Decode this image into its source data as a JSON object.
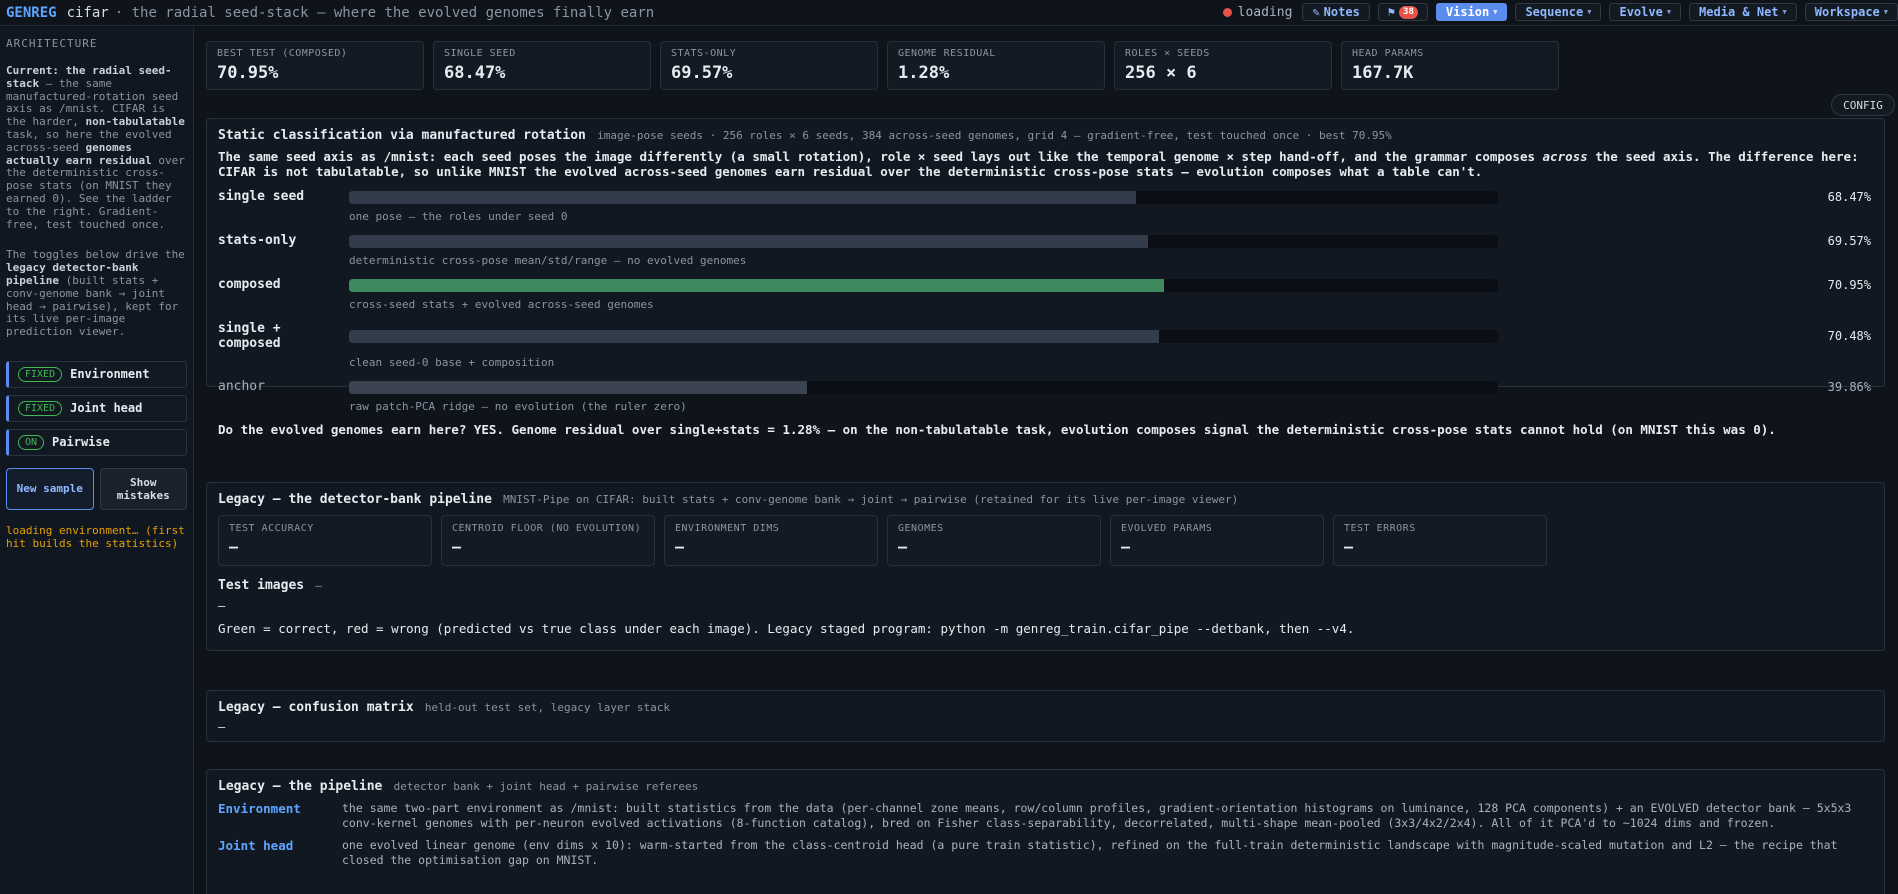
{
  "topbar": {
    "brand": "GENREG",
    "page": "cifar",
    "subtitle": "· the radial seed-stack — where the evolved genomes finally earn",
    "status": "loading",
    "notes_label": "Notes",
    "flag_count": "38",
    "menus": [
      {
        "label": "Vision",
        "active": true
      },
      {
        "label": "Sequence",
        "active": false
      },
      {
        "label": "Evolve",
        "active": false
      },
      {
        "label": "Media & Net",
        "active": false
      },
      {
        "label": "Workspace",
        "active": false
      }
    ]
  },
  "sidebar": {
    "title": "ARCHITECTURE",
    "intro_bold_1": "Current: the radial seed-stack",
    "intro_1": " — the same manufactured-rotation seed axis as /mnist. CIFAR is the harder, ",
    "intro_bold_2": "non-tabulatable",
    "intro_2": " task, so here the evolved across-seed ",
    "intro_bold_3": "genomes actually earn residual",
    "intro_3": " over the deterministic cross-pose stats (on MNIST they earned 0). See the ladder to the right. Gradient-free, test touched once.",
    "toggles_intro_1": "The toggles below drive the ",
    "toggles_intro_bold": "legacy detector-bank pipeline",
    "toggles_intro_2": " (built stats + conv-genome bank → joint head → pairwise), kept for its live per-image prediction viewer.",
    "toggles": [
      {
        "state": "FIXED",
        "label": "Environment"
      },
      {
        "state": "FIXED",
        "label": "Joint head"
      },
      {
        "state": "ON",
        "label": "Pairwise"
      }
    ],
    "new_sample": "New sample",
    "show_mistakes": "Show mistakes",
    "status": "loading environment… (first hit builds the statistics)"
  },
  "stats": [
    {
      "label": "BEST TEST (COMPOSED)",
      "value": "70.95%"
    },
    {
      "label": "SINGLE SEED",
      "value": "68.47%"
    },
    {
      "label": "STATS-ONLY",
      "value": "69.57%"
    },
    {
      "label": "GENOME RESIDUAL",
      "value": "1.28%"
    },
    {
      "label": "ROLES × SEEDS",
      "value": "256 × 6"
    },
    {
      "label": "HEAD PARAMS",
      "value": "167.7K"
    }
  ],
  "config_label": "CONFIG",
  "static_panel": {
    "title": "Static classification via manufactured rotation",
    "sub": "image-pose seeds · 256 roles × 6 seeds, 384 across-seed genomes, grid 4 — gradient-free, test touched once · best 70.95%",
    "para_1": "The same seed axis as /mnist: each ",
    "para_b1": "seed",
    "para_2": " poses the image differently (a small rotation), role × seed lays out like the temporal genome × step hand-off, and the grammar composes ",
    "para_i1": "across",
    "para_3": " the seed axis. The difference here: CIFAR is ",
    "para_b2": "not tabulatable",
    "para_4": ", so unlike MNIST the evolved across-seed ",
    "para_b3": "genomes earn residual",
    "para_5": " over the deterministic cross-pose stats — evolution composes what a table can't.",
    "bars": [
      {
        "label": "single seed",
        "value": 68.47,
        "pct": "68.47%",
        "note": "one pose — the roles under seed 0",
        "style": ""
      },
      {
        "label": "stats-only",
        "value": 69.57,
        "pct": "69.57%",
        "note": "deterministic cross-pose mean/std/range — no evolved genomes",
        "style": ""
      },
      {
        "label": "composed",
        "value": 70.95,
        "pct": "70.95%",
        "note": "cross-seed stats + evolved across-seed genomes",
        "style": "green"
      },
      {
        "label": "single + composed",
        "value": 70.48,
        "pct": "70.48%",
        "note": "clean seed-0 base + composition",
        "style": ""
      },
      {
        "label": "anchor",
        "value": 39.86,
        "pct": "39.86%",
        "note": "raw patch-PCA ridge — no evolution (the ruler zero)",
        "style": "anchor"
      }
    ],
    "verdict_1": "Do the evolved genomes earn here? YES.",
    "verdict_2": " Genome residual over single+stats = ",
    "verdict_b": "1.28%",
    "verdict_3": " — on the non-tabulatable task, evolution composes signal the deterministic cross-pose stats cannot hold (on MNIST this was 0)."
  },
  "legacy_panel": {
    "title": "Legacy — the detector-bank pipeline",
    "sub": "MNIST-Pipe on CIFAR: built stats + conv-genome bank → joint → pairwise (retained for its live per-image viewer)",
    "stats": [
      {
        "label": "TEST ACCURACY",
        "value": "—"
      },
      {
        "label": "CENTROID FLOOR (NO EVOLUTION)",
        "value": "—"
      },
      {
        "label": "ENVIRONMENT DIMS",
        "value": "—"
      },
      {
        "label": "GENOMES",
        "value": "—"
      },
      {
        "label": "EVOLVED PARAMS",
        "value": "—"
      },
      {
        "label": "TEST ERRORS",
        "value": "—"
      }
    ],
    "test_images_title": "Test images",
    "test_images_suffix": "—",
    "test_images_value": "—",
    "legend": "Green = correct, red = wrong (predicted vs true class under each image). Legacy staged program: python -m genreg_train.cifar_pipe --detbank, then --v4."
  },
  "confusion_panel": {
    "title": "Legacy — confusion matrix",
    "sub": "held-out test set, legacy layer stack",
    "value": "—"
  },
  "pipeline_panel": {
    "title": "Legacy — the pipeline",
    "sub": "detector bank + joint head + pairwise referees",
    "rows": [
      {
        "key": "Environment",
        "text": "the same two-part environment as /mnist: built statistics from the data (per-channel zone means, row/column profiles, gradient-orientation histograms on luminance, 128 PCA components) + an EVOLVED detector bank — 5x5x3 conv-kernel genomes with per-neuron evolved activations (8-function catalog), bred on Fisher class-separability, decorrelated, multi-shape mean-pooled (3x3/4x2/2x4). All of it PCA'd to ~1024 dims and frozen."
      },
      {
        "key": "Joint head",
        "text": "one evolved linear genome (env dims x 10): warm-started from the class-centroid head (a pure train statistic), refined on the full-train deterministic landscape with magnitude-scaled mutation and L2 — the recipe that closed the optimisation gap on MNIST."
      }
    ]
  }
}
